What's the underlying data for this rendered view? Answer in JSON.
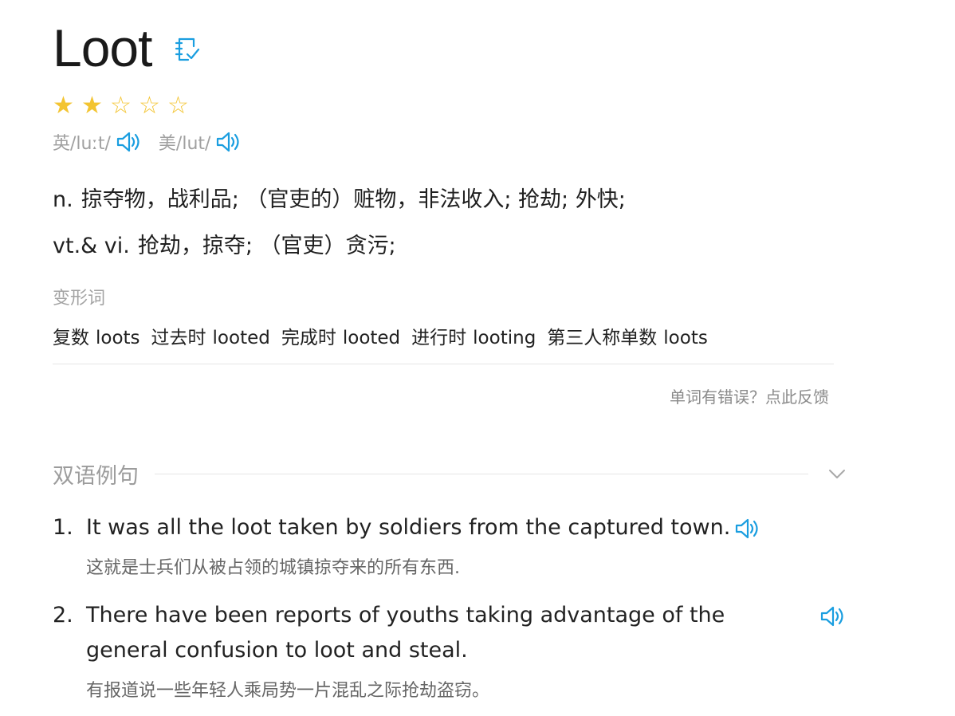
{
  "word": {
    "title": "Loot",
    "rating": {
      "value": 2,
      "max": 5
    },
    "stars": [
      "★",
      "★",
      "☆",
      "☆",
      "☆"
    ],
    "phonetics": [
      {
        "text": "英/luːt/"
      },
      {
        "text": "美/lut/"
      }
    ]
  },
  "definitions": [
    {
      "pos": "n.",
      "meaning": "掠夺物，战利品; （官吏的）赃物，非法收入; 抢劫; 外快;"
    },
    {
      "pos": "vt.& vi.",
      "meaning": "抢劫，掠夺; （官吏）贪污;"
    }
  ],
  "forms": {
    "label": "变形词",
    "items": [
      {
        "type": "复数",
        "value": "loots"
      },
      {
        "type": "过去时",
        "value": "looted"
      },
      {
        "type": "完成时",
        "value": "looted"
      },
      {
        "type": "进行时",
        "value": "looting"
      },
      {
        "type": "第三人称单数",
        "value": "loots"
      }
    ]
  },
  "feedback": {
    "label": "单词有错误？点此反馈"
  },
  "examples": {
    "title": "双语例句",
    "items": [
      {
        "num": "1.",
        "en": "It was all the loot taken by soldiers from the captured town.",
        "cn": "这就是士兵们从被占领的城镇掠夺来的所有东西."
      },
      {
        "num": "2.",
        "en_line1": "There have been reports of youths taking advantage of the",
        "en_line2": "general confusion to loot and steal.",
        "cn": "有报道说一些年轻人乘局势一片混乱之际抢劫盗窃。"
      }
    ]
  },
  "icons": {
    "wordbook": "notebook-check-icon",
    "speaker": "speaker-icon",
    "chevron": "chevron-down-icon"
  },
  "colors": {
    "accent": "#1a9ee0",
    "star": "#f3c431"
  }
}
